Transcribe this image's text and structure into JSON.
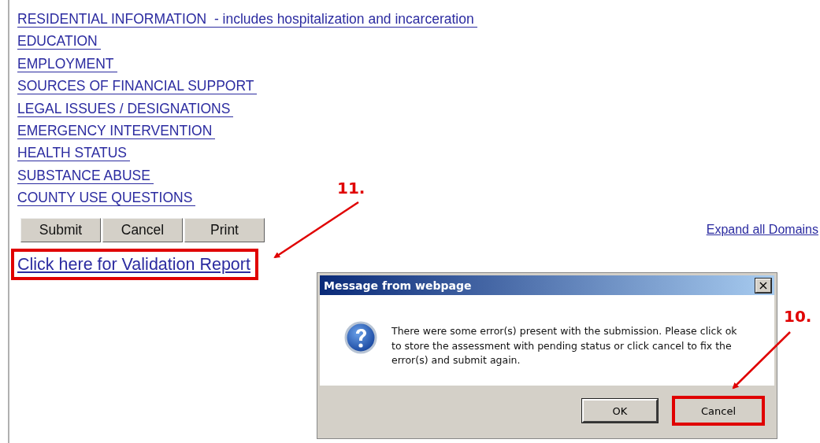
{
  "domain_links": [
    {
      "label": "RESIDENTIAL INFORMATION  - includes hospitalization and incarceration"
    },
    {
      "label": "EDUCATION"
    },
    {
      "label": "EMPLOYMENT"
    },
    {
      "label": "SOURCES OF FINANCIAL SUPPORT"
    },
    {
      "label": "LEGAL ISSUES / DESIGNATIONS"
    },
    {
      "label": "EMERGENCY INTERVENTION"
    },
    {
      "label": "HEALTH STATUS"
    },
    {
      "label": "SUBSTANCE ABUSE"
    },
    {
      "label": "COUNTY USE QUESTIONS"
    }
  ],
  "form_buttons": [
    {
      "label": "Submit"
    },
    {
      "label": "Cancel"
    },
    {
      "label": "Print"
    }
  ],
  "expand_link": "Expand all Domains",
  "validation_link": {
    "label": "Click here for Validation Report",
    "highlighted": true
  },
  "dialog": {
    "title": "Message from webpage",
    "close": "×",
    "message": "There were some error(s) present with the submission. Please click ok to store the assessment with pending status or click cancel to fix the error(s) and submit again.",
    "buttons": [
      {
        "label": "OK",
        "highlighted": false
      },
      {
        "label": "Cancel",
        "highlighted": true
      }
    ]
  },
  "annotations": [
    {
      "label": "11."
    },
    {
      "label": "10."
    }
  ]
}
